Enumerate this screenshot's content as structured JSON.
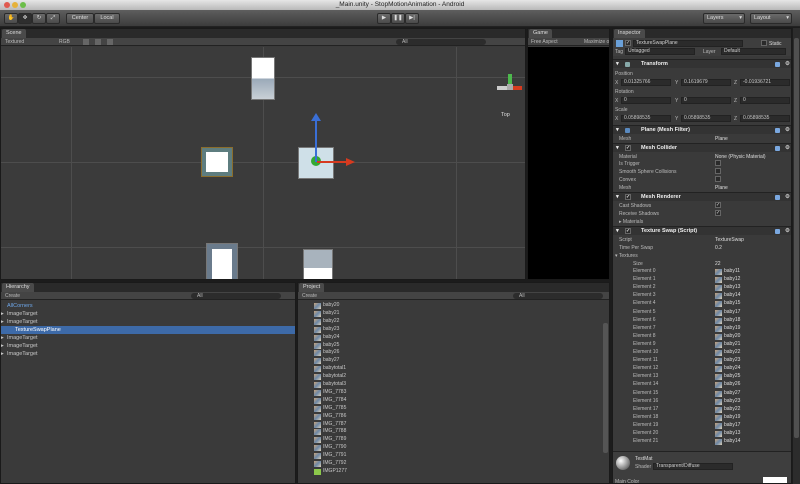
{
  "window": {
    "title": "_Main.unity - StopMotionAnimation - Android"
  },
  "toolbar": {
    "center": "Center",
    "local": "Local",
    "layers": "Layers",
    "layout": "Layout"
  },
  "scene": {
    "tab": "Scene",
    "shading": "Textured",
    "render": "RGB",
    "search": "All",
    "view_label": "Top"
  },
  "game": {
    "tab": "Game",
    "aspect": "Free Aspect",
    "maximize": "Maximize on"
  },
  "hierarchy": {
    "tab": "Hierarchy",
    "create": "Create",
    "search": "All",
    "items": [
      "AllCorners",
      "ImageTarget",
      "ImageTarget",
      "TextureSwapPlane",
      "ImageTarget",
      "ImageTarget",
      "ImageTarget"
    ]
  },
  "project": {
    "tab": "Project",
    "create": "Create",
    "search": "All",
    "items": [
      "baby20",
      "baby21",
      "baby22",
      "baby23",
      "baby24",
      "baby25",
      "baby26",
      "baby27",
      "babytotal1",
      "babytotal2",
      "babytotal3",
      "IMG_7783",
      "IMG_7784",
      "IMG_7785",
      "IMG_7786",
      "IMG_7787",
      "IMG_7788",
      "IMG_7789",
      "IMG_7790",
      "IMG_7791",
      "IMG_7792",
      "IMGP1277"
    ]
  },
  "inspector": {
    "tab": "Inspector",
    "object_name": "TextureSwapPlane",
    "static": "Static",
    "tag_label": "Tag",
    "tag": "Untagged",
    "layer_label": "Layer",
    "layer": "Default",
    "transform": {
      "title": "Transform",
      "position": "Position",
      "rotation": "Rotation",
      "scale": "Scale",
      "pos": [
        "0.01325766",
        "0.1619679",
        "-0.01936721"
      ],
      "rot": [
        "0",
        "0",
        "0"
      ],
      "scl": [
        "0.05898535",
        "0.05898535",
        "0.05898535"
      ],
      "axes": [
        "X",
        "Y",
        "Z"
      ]
    },
    "mesh_filter": {
      "title": "Plane (Mesh Filter)",
      "mesh_label": "Mesh",
      "mesh": "Plane"
    },
    "mesh_collider": {
      "title": "Mesh Collider",
      "material_label": "Material",
      "material": "None (Physic Material)",
      "is_trigger": "Is Trigger",
      "smooth": "Smooth Sphere Collisions",
      "convex": "Convex",
      "mesh_label": "Mesh",
      "mesh": "Plane"
    },
    "mesh_renderer": {
      "title": "Mesh Renderer",
      "cast": "Cast Shadows",
      "receive": "Receive Shadows",
      "materials": "Materials"
    },
    "script_comp": {
      "title": "Texture Swap (Script)",
      "script_label": "Script",
      "script": "TextureSwap",
      "time_label": "Time Per Swap",
      "time": "0.2",
      "textures": "Textures",
      "size_label": "Size",
      "size": "22"
    },
    "elements": [
      {
        "label": "Element 0",
        "value": "baby11"
      },
      {
        "label": "Element 1",
        "value": "baby12"
      },
      {
        "label": "Element 2",
        "value": "baby13"
      },
      {
        "label": "Element 3",
        "value": "baby14"
      },
      {
        "label": "Element 4",
        "value": "baby15"
      },
      {
        "label": "Element 5",
        "value": "baby17"
      },
      {
        "label": "Element 6",
        "value": "baby18"
      },
      {
        "label": "Element 7",
        "value": "baby19"
      },
      {
        "label": "Element 8",
        "value": "baby20"
      },
      {
        "label": "Element 9",
        "value": "baby21"
      },
      {
        "label": "Element 10",
        "value": "baby22"
      },
      {
        "label": "Element 11",
        "value": "baby23"
      },
      {
        "label": "Element 12",
        "value": "baby24"
      },
      {
        "label": "Element 13",
        "value": "baby25"
      },
      {
        "label": "Element 14",
        "value": "baby26"
      },
      {
        "label": "Element 15",
        "value": "baby27"
      },
      {
        "label": "Element 16",
        "value": "baby23"
      },
      {
        "label": "Element 17",
        "value": "baby22"
      },
      {
        "label": "Element 18",
        "value": "baby19"
      },
      {
        "label": "Element 19",
        "value": "baby17"
      },
      {
        "label": "Element 20",
        "value": "baby13"
      },
      {
        "label": "Element 21",
        "value": "baby14"
      }
    ],
    "material": {
      "name": "TestMat",
      "shader_label": "Shader",
      "shader": "Transparent/Diffuse",
      "main_color": "Main Color"
    }
  },
  "colors": {
    "selection": "#3d6aa8",
    "game_bg": "#000000",
    "panel": "#3a3a3a"
  }
}
